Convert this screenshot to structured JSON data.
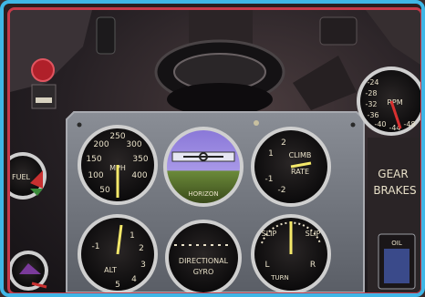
{
  "window": {
    "background": "#2a1e20",
    "outer_border": "#3fb6e6",
    "inner_border": "#c63a4a"
  },
  "gauges": {
    "airspeed": {
      "ticks": [
        "250",
        "300",
        "200",
        "350",
        "150",
        "400",
        "100",
        "50"
      ],
      "center_label": "MPH"
    },
    "attitude": {
      "label": "HORIZON"
    },
    "climb": {
      "ticks": [
        "2",
        "1",
        "-1",
        "-2"
      ],
      "label1": "CLIMB",
      "label2": "RATE"
    },
    "altimeter": {
      "ticks": [
        "1",
        "2",
        "3",
        "4",
        "5",
        "-1"
      ],
      "label": "ALT"
    },
    "directional_gyro": {
      "label1": "DIRECTIONAL",
      "label2": "GYRO"
    },
    "turn_slip": {
      "slip_left": "SLIP",
      "slip_right": "SLIP",
      "turn": "TURN",
      "left": "L",
      "right": "R"
    },
    "fuel": {
      "label": "FUEL"
    },
    "rpm": {
      "ticks": [
        "-24",
        "-28",
        "-32",
        "-36",
        "-40",
        "-44",
        "-48"
      ],
      "label": "RPM"
    },
    "side_panel": {
      "gear": "GEAR",
      "brakes": "BRAKES"
    },
    "oil_label": "OIL"
  }
}
